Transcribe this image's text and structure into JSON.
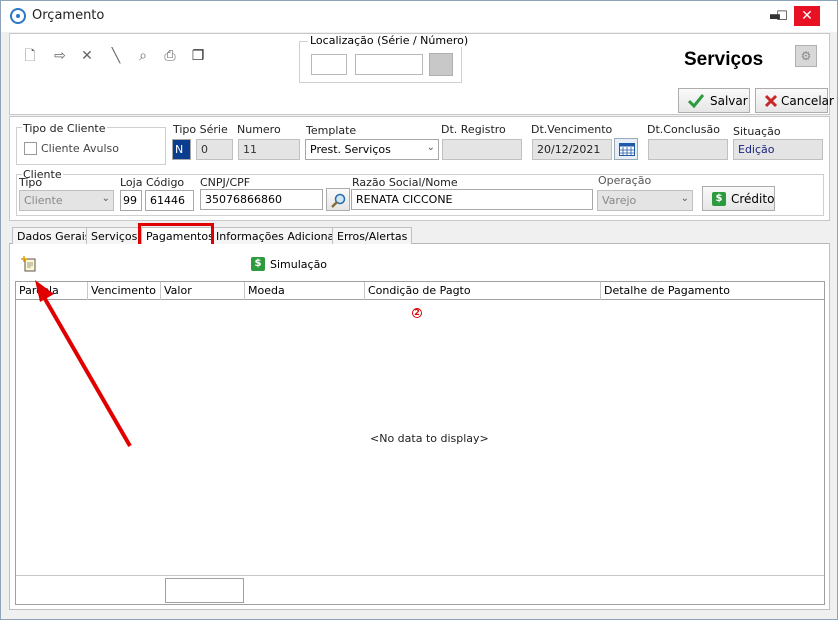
{
  "window": {
    "title": "Orçamento",
    "minimize": "▬",
    "maximize": "☐",
    "close": "✕"
  },
  "toolbar": {
    "icons": [
      "new-doc-icon",
      "edit-icon",
      "delete-icon",
      "pen-icon",
      "search-doc-icon",
      "print-icon",
      "copy-icon"
    ],
    "localizacao_label": "Localização (Série / Número)",
    "localizacao_serie": "",
    "localizacao_numero": "",
    "page_heading": "Serviços"
  },
  "actions": {
    "save_label": "Salvar",
    "cancel_label": "Cancelar"
  },
  "form": {
    "tipo_cliente_label": "Tipo de Cliente",
    "cliente_avulso_label": "Cliente Avulso",
    "tipo_serie_label": "Tipo Série",
    "tipo_serie_value": "N",
    "serie_value": "0",
    "numero_label": "Numero",
    "numero_value": "11",
    "template_label": "Template",
    "template_value": "Prest. Serviços",
    "dt_registro_label": "Dt. Registro",
    "dt_registro_value": "",
    "dt_vencimento_label": "Dt.Vencimento",
    "dt_vencimento_value": "20/12/2021",
    "dt_conclusao_label": "Dt.Conclusão",
    "dt_conclusao_value": "",
    "situacao_label": "Situação",
    "situacao_value": "Edição",
    "cliente_group_label": "Cliente",
    "tipo_label": "Tipo",
    "tipo_value": "Cliente",
    "loja_label": "Loja",
    "loja_value": "99",
    "codigo_label": "Código",
    "codigo_value": "61446",
    "cnpj_label": "CNPJ/CPF",
    "cnpj_value": "35076866860",
    "razao_label": "Razão Social/Nome",
    "razao_value": "RENATA CICCONE",
    "operacao_label": "Operação",
    "operacao_value": "Varejo",
    "credito_label": "Crédito"
  },
  "tabs": [
    {
      "label": "Dados Gerais"
    },
    {
      "label": "Serviços"
    },
    {
      "label": "Pagamentos"
    },
    {
      "label": "Informações Adicionais"
    },
    {
      "label": "Erros/Alertas"
    }
  ],
  "pagamentos": {
    "simulacao_label": "Simulação",
    "columns": [
      "Parcela",
      "Vencimento",
      "Valor",
      "Moeda",
      "Condição de Pagto",
      "Detalhe de Pagamento"
    ],
    "empty_text": "<No data to display>",
    "badge_value": "2",
    "footer_value": ""
  },
  "colors": {
    "highlight": "#e00000",
    "accent_text": "#1a237e",
    "dollar_green": "#2e9a3e"
  }
}
